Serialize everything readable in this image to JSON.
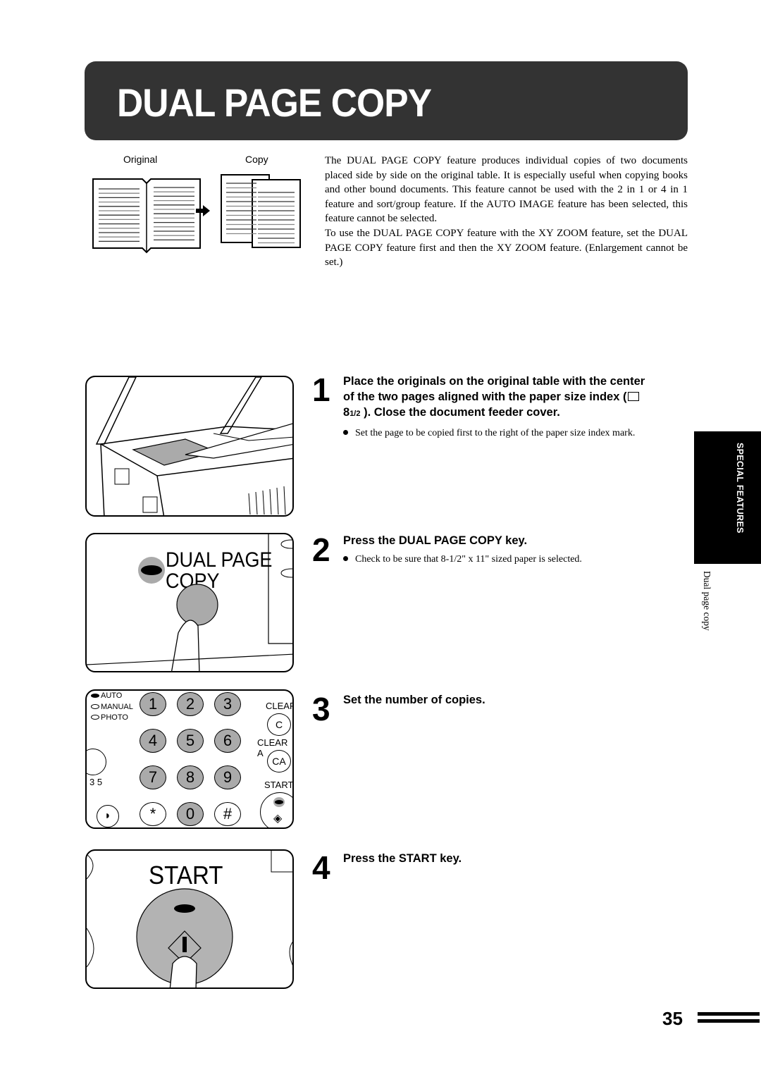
{
  "header": {
    "title": "DUAL PAGE COPY"
  },
  "illustration": {
    "original_label": "Original",
    "copy_label": "Copy"
  },
  "intro": {
    "paragraphs": [
      "The DUAL PAGE COPY feature produces individual copies of two documents placed side by side on the original table. It is especially useful when copying books and other bound documents. This feature cannot be used with the 2 in 1 or 4 in 1 feature and sort/group feature. If the AUTO IMAGE feature has been selected, this feature cannot be selected.",
      "To use the DUAL PAGE COPY feature with the XY ZOOM feature, set the DUAL PAGE COPY feature first and then the XY ZOOM feature. (Enlargement cannot be set.)"
    ]
  },
  "steps": [
    {
      "number": "1",
      "heading_line1": "Place the originals on the original table with the center",
      "heading_line2": "of the two pages aligned with the paper size index (",
      "heading_line3_num": "8",
      "heading_line3_frac": "1/2",
      "heading_line3_rest": " ). Close the document feeder cover.",
      "bullet": "Set the page to be copied first to the right of the paper size index mark."
    },
    {
      "number": "2",
      "heading": "Press the DUAL PAGE COPY key.",
      "bullet": "Check to be sure that 8-1/2\" x 11\" sized paper is selected."
    },
    {
      "number": "3",
      "heading": "Set the number of copies."
    },
    {
      "number": "4",
      "heading": "Press the START key."
    }
  ],
  "panels": {
    "dual_key_label_line1": "DUAL PAGE",
    "dual_key_label_line2": "COPY",
    "keypad": {
      "modes": [
        "AUTO",
        "MANUAL",
        "PHOTO"
      ],
      "keys": [
        "1",
        "2",
        "3",
        "4",
        "5",
        "6",
        "7",
        "8",
        "9",
        "*",
        "0",
        "#"
      ],
      "clear_label": "CLEAR",
      "clear_key": "C",
      "clear_all_label": "CLEAR A",
      "clear_all_key": "CA",
      "start_label": "START",
      "exposure_scale": "3  5"
    },
    "start_label": "START"
  },
  "sidebar": {
    "section": "SPECIAL FEATURES",
    "subsection": "Dual page copy"
  },
  "footer": {
    "page_number": "35"
  }
}
